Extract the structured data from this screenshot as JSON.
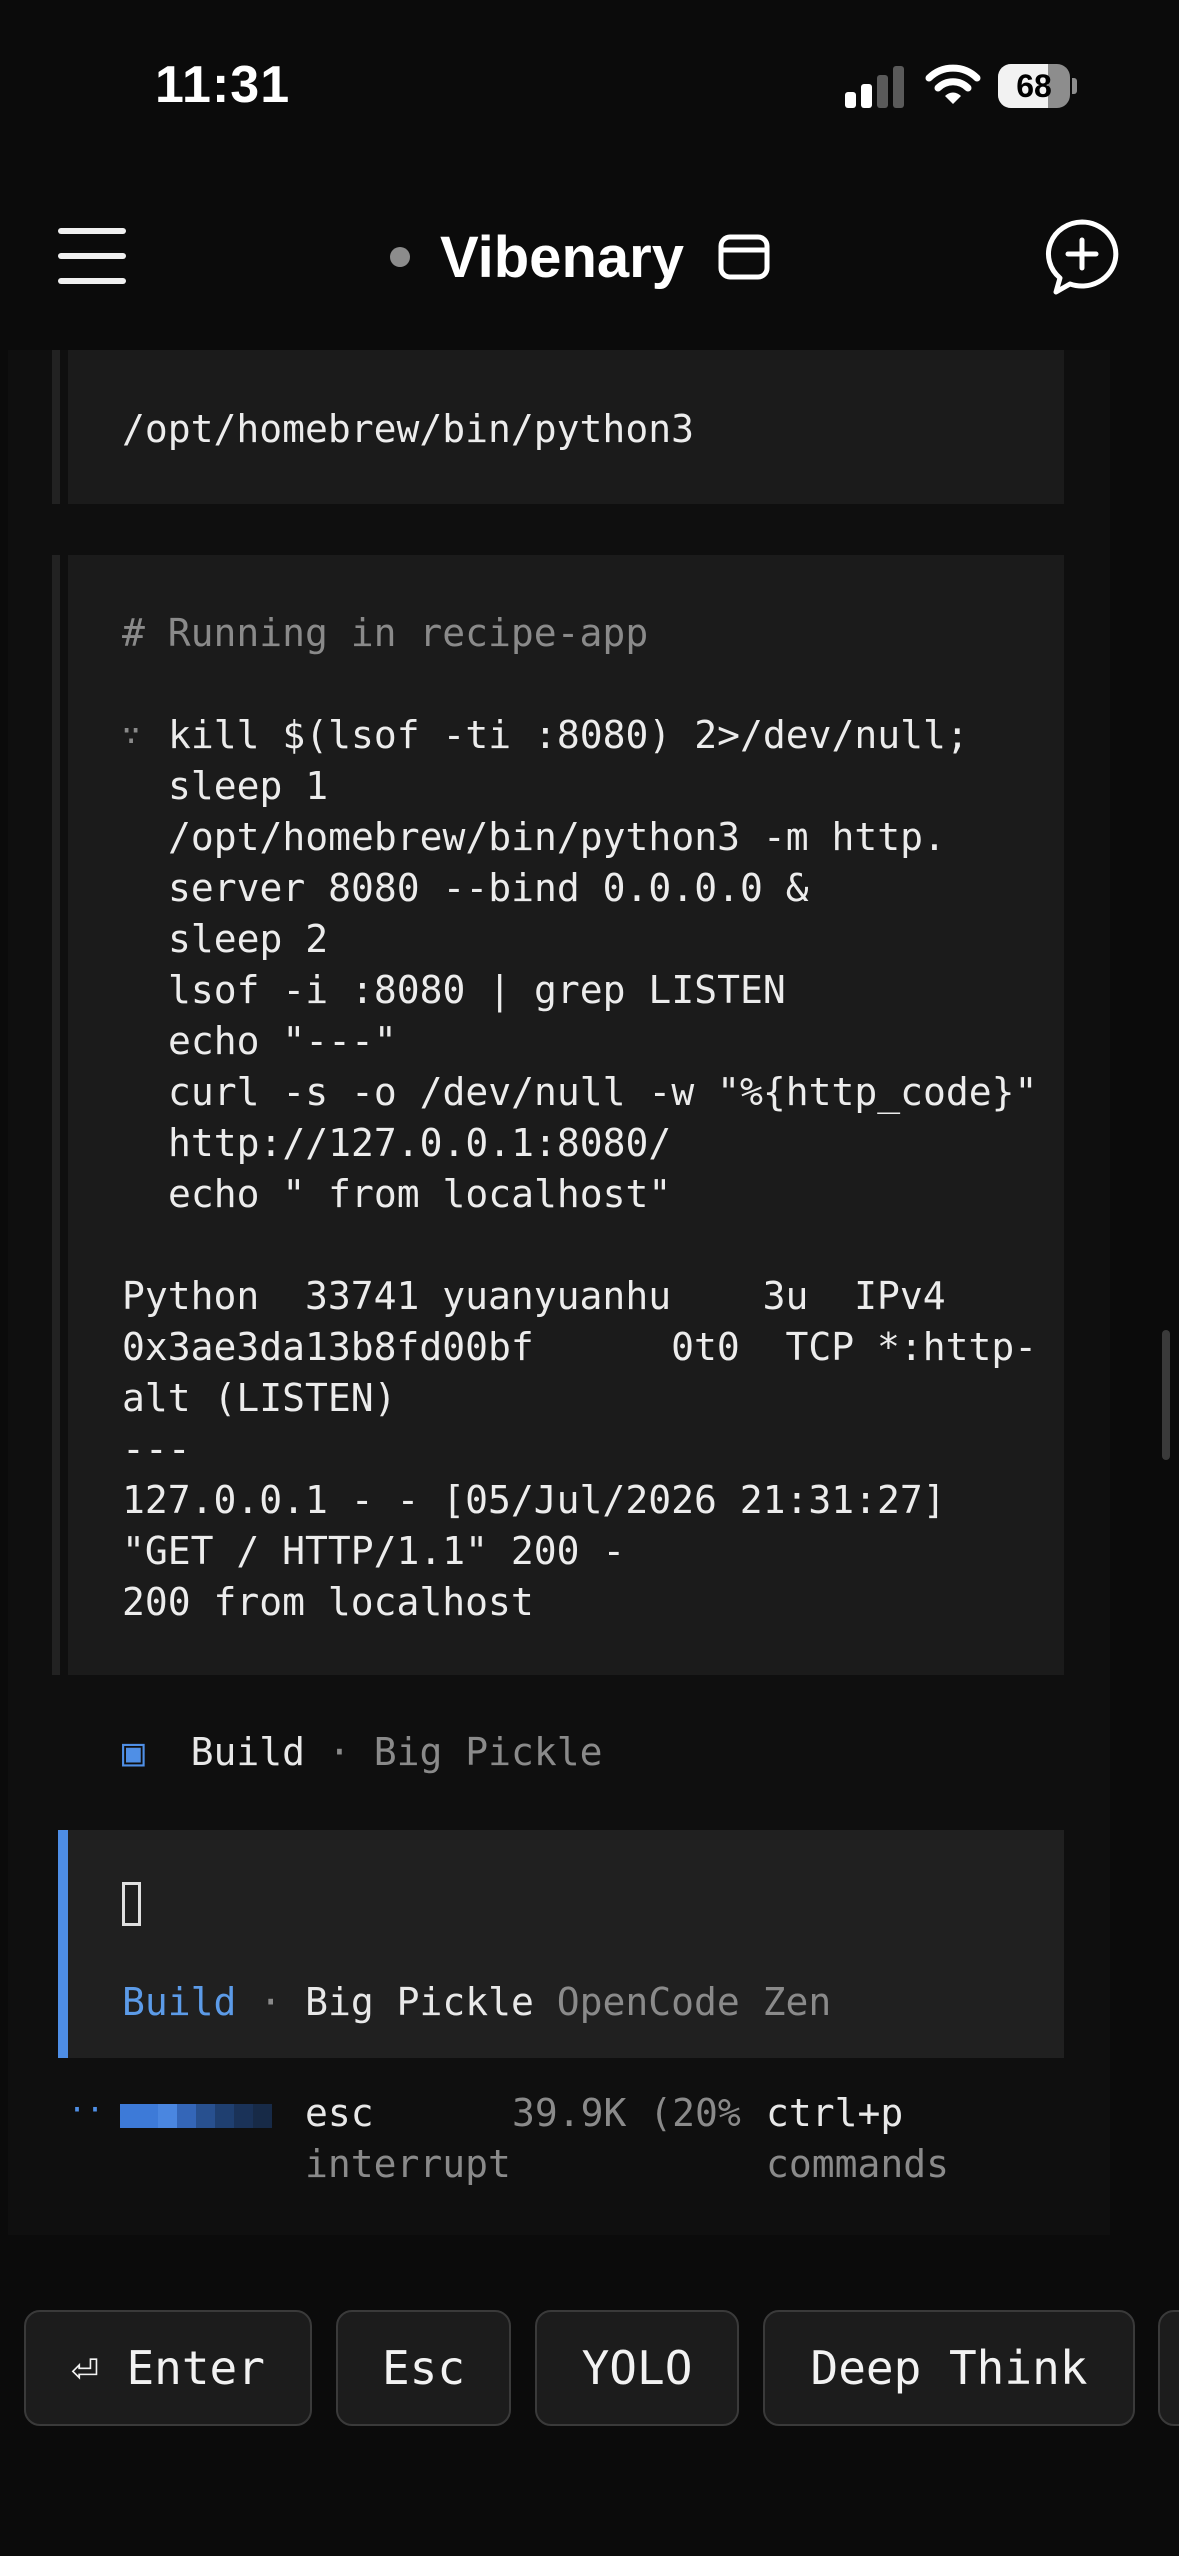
{
  "status_bar": {
    "time": "11:31",
    "battery": "68"
  },
  "header": {
    "title": "Vibenary"
  },
  "terminal": {
    "prev_output": "/opt/homebrew/bin/python3",
    "comment": "# Running in recipe-app",
    "command_marker": "∵",
    "command_lines": [
      "kill $(lsof -ti :8080) 2>/dev/null;",
      "sleep 1",
      "/opt/homebrew/bin/python3 -m http.",
      "server 8080 --bind 0.0.0.0 &",
      "sleep 2",
      "lsof -i :8080 | grep LISTEN",
      "echo \"---\"",
      "curl -s -o /dev/null -w \"%{http_code}\"",
      "http://127.0.0.1:8080/",
      "echo \" from localhost\""
    ],
    "output_lines": [
      "Python  33741 yuanyuanhu    3u  IPv4",
      "0x3ae3da13b8fd00bf      0t0  TCP *:http-",
      "alt (LISTEN)",
      "---",
      "127.0.0.1 - - [05/Jul/2026 21:31:27]",
      "\"GET / HTTP/1.1\" 200 -",
      "200 from localhost"
    ]
  },
  "agent": {
    "mode": "Build",
    "separator": "·",
    "model": "Big Pickle",
    "provider": "OpenCode Zen"
  },
  "footer": {
    "spinner": "··",
    "progress_colors": [
      "#3d7ad8",
      "#3d7ad8",
      "#4a86e0",
      "#3466b8",
      "#28508f",
      "#1f3f70",
      "#1a3258",
      "#172a47"
    ],
    "esc_key": "esc",
    "esc_label": "interrupt",
    "tokens": "39.9K (20%",
    "cmd_key": "ctrl+p",
    "cmd_label": "commands"
  },
  "quick_keys": [
    {
      "label": "⏎ Enter",
      "icon": "return-icon"
    },
    {
      "label": "Esc"
    },
    {
      "label": "YOLO"
    },
    {
      "label": "Deep Think"
    }
  ]
}
